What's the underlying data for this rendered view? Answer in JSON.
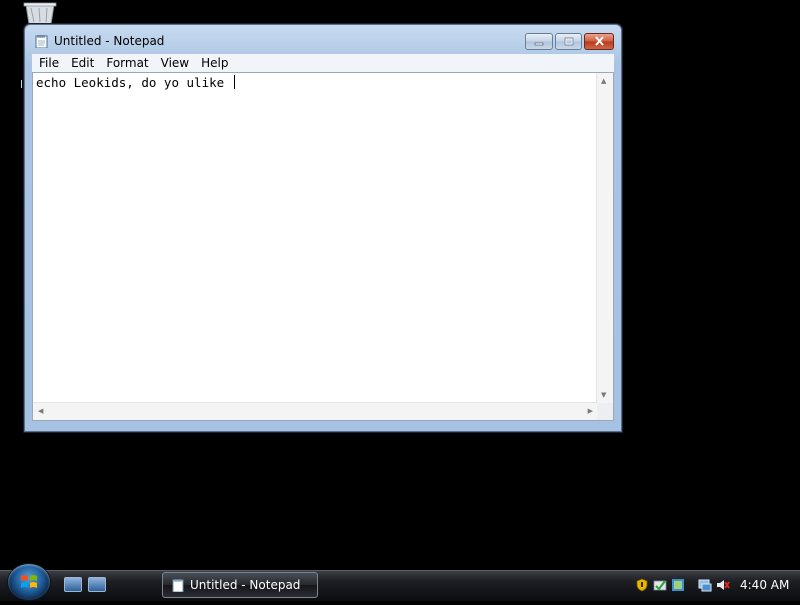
{
  "desktop": {
    "recycle_bin_icon": "recycle-bin-icon",
    "partial_label": "l"
  },
  "window": {
    "title": "Untitled - Notepad",
    "icon": "notepad-icon",
    "controls": {
      "minimize": "minimize-icon",
      "maximize": "maximize-icon",
      "close": "close-icon"
    },
    "menu": [
      {
        "label": "File"
      },
      {
        "label": "Edit"
      },
      {
        "label": "Format"
      },
      {
        "label": "View"
      },
      {
        "label": "Help"
      }
    ],
    "editor_text": "echo Leokids, do yo ulike "
  },
  "taskbar": {
    "start_icon": "windows-start-orb",
    "quick_launch": [
      "show-desktop-icon",
      "switch-windows-icon"
    ],
    "task_button_label": "Untitled - Notepad",
    "tray_icons": [
      "security-shield-icon",
      "windows-defender-icon",
      "network-icon",
      "volume-muted-icon"
    ],
    "clock": "4:40 AM"
  },
  "colors": {
    "window_frame": "#a8c3e3",
    "close_button": "#cf5a3c",
    "taskbar": "#1e2024",
    "desktop": "#000000"
  }
}
